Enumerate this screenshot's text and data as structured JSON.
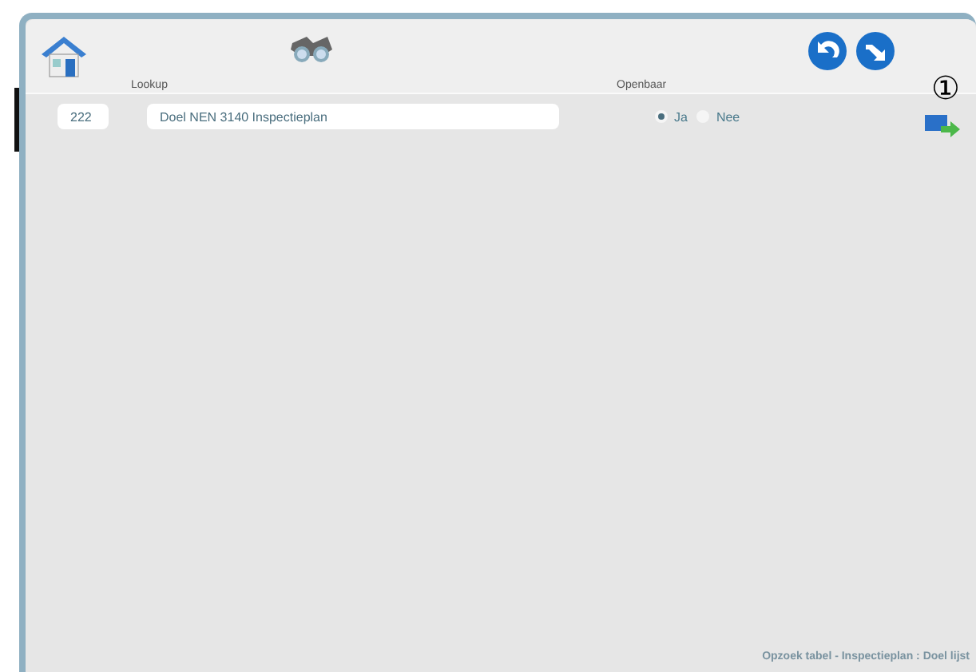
{
  "record": {
    "number": "222",
    "lookup_label": "Lookup",
    "lookup_value": "Doel NEN 3140 Inspectieplan",
    "openbaar_label": "Openbaar",
    "options": [
      {
        "label": "Ja",
        "selected": true
      },
      {
        "label": "Nee",
        "selected": false
      }
    ],
    "badge": "①"
  },
  "footer": "Opzoek tabel - Inspectieplan :  Doel lijst"
}
